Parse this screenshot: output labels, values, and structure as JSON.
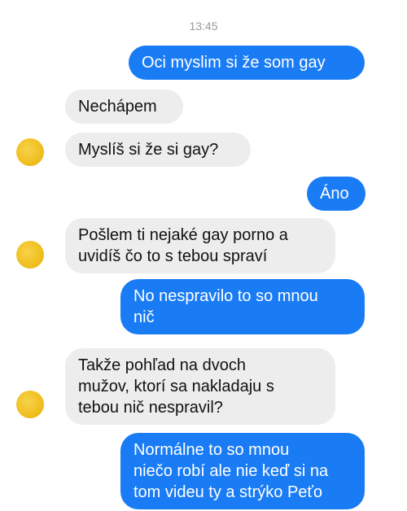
{
  "chat": {
    "timestamp": "13:45",
    "messages": [
      {
        "side": "out",
        "lines": [
          "Oci myslim si že som gay"
        ]
      },
      {
        "side": "in",
        "lines": [
          "Nechápem"
        ]
      },
      {
        "side": "in",
        "lines": [
          "Myslíš si že si gay?"
        ]
      },
      {
        "side": "out",
        "lines": [
          "Áno"
        ]
      },
      {
        "side": "in",
        "lines": [
          "Pošlem ti nejaké gay porno a",
          "uvidíš čo to s tebou spraví"
        ]
      },
      {
        "side": "out",
        "lines": [
          "No nespravilo to so mnou",
          "nič"
        ]
      },
      {
        "side": "in",
        "lines": [
          "Takže pohľad na dvoch",
          "mužov, ktorí sa nakladaju s",
          "tebou nič nespravil?"
        ]
      },
      {
        "side": "out",
        "lines": [
          "Normálne to so mnou",
          "niečo robí ale nie keď si na",
          "tom videu ty a strýko Peťo"
        ]
      }
    ]
  },
  "colors": {
    "outgoing_bubble": "#1a7cf5",
    "incoming_bubble": "#ededed",
    "avatar": "#f0bf1f"
  }
}
